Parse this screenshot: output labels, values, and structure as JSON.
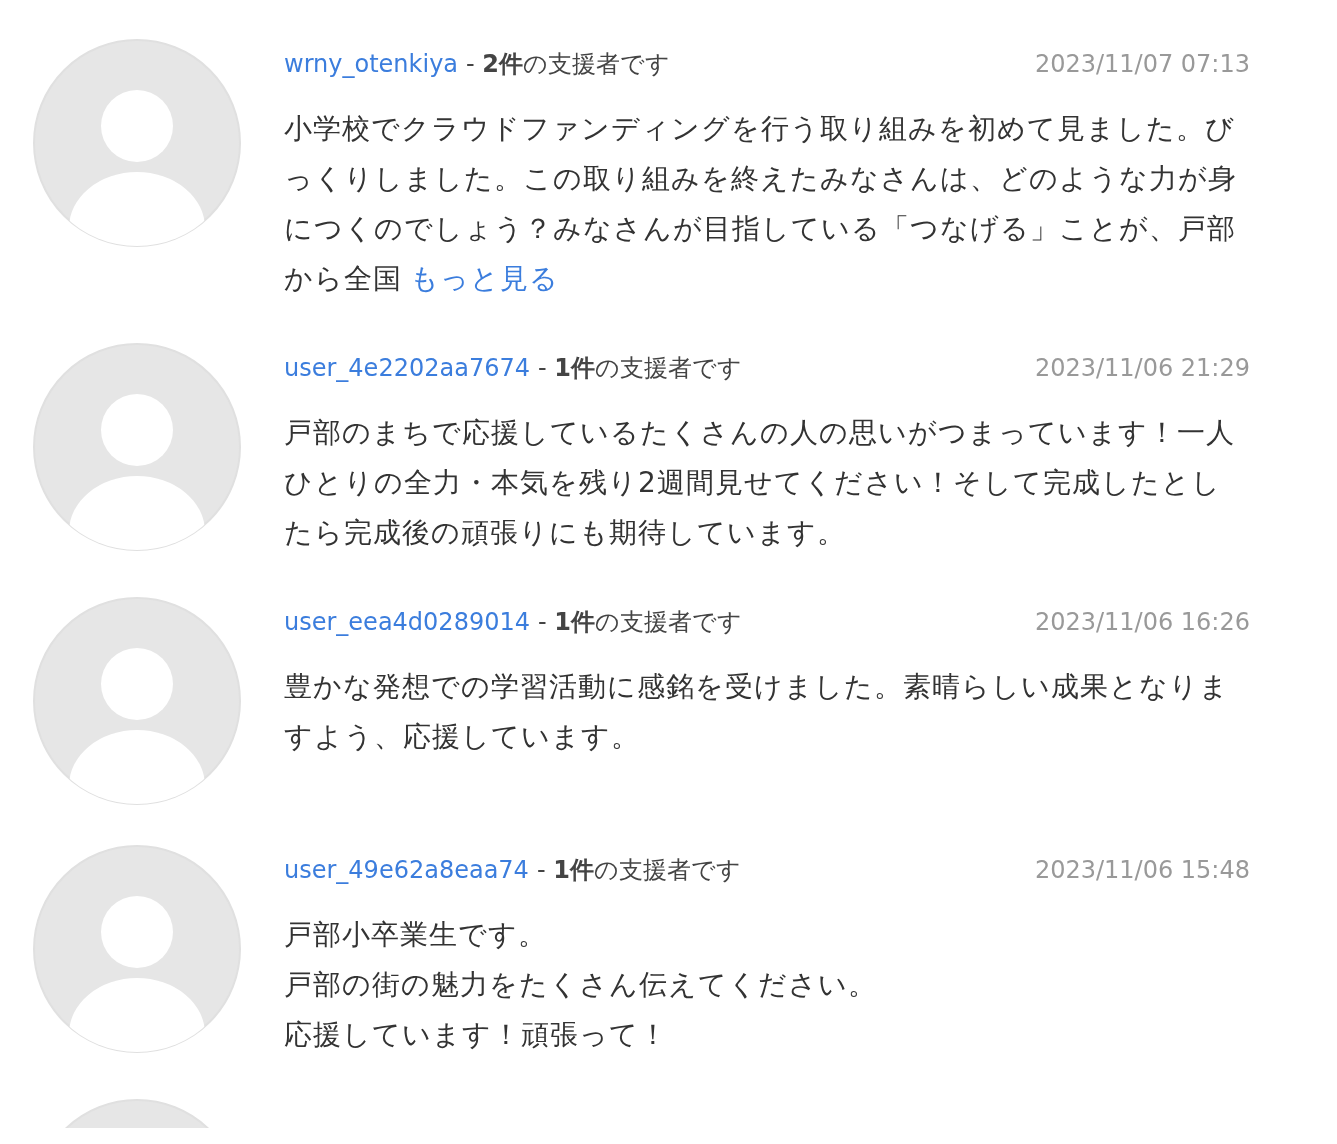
{
  "comments": [
    {
      "user": "wrny_otenkiya",
      "supporter": "- **2件**の支援者です",
      "date": "2023/11/07 07:13",
      "lines": [
        "小学校でクラウドファンディングを行う取り組みを初めて見ました。びっくりしました。この取り組みを終えたみなさんは、どのような力が身につくのでしょう？みなさんが目指している「つなげる」ことが、戸部から全国"
      ],
      "more_link": "もっと見る"
    },
    {
      "user": "user_4e2202aa7674",
      "supporter": "- **1件**の支援者です",
      "date": "2023/11/06 21:29",
      "lines": [
        "戸部のまちで応援しているたくさんの人の思いがつまっています！一人ひとりの全力・本気を残り2週間見せてください！そして完成したとしたら完成後の頑張りにも期待しています。"
      ]
    },
    {
      "user": "user_eea4d0289014",
      "supporter": "- **1件**の支援者です",
      "date": "2023/11/06 16:26",
      "lines": [
        "豊かな発想での学習活動に感銘を受けました。素晴らしい成果となりますよう、応援しています。"
      ]
    },
    {
      "user": "user_49e62a8eaa74",
      "supporter": "- **1件**の支援者です",
      "date": "2023/11/06 15:48",
      "lines": [
        "戸部小卒業生です。",
        "戸部の街の魅力をたくさん伝えてください。",
        "応援しています！頑張って！"
      ]
    }
  ]
}
